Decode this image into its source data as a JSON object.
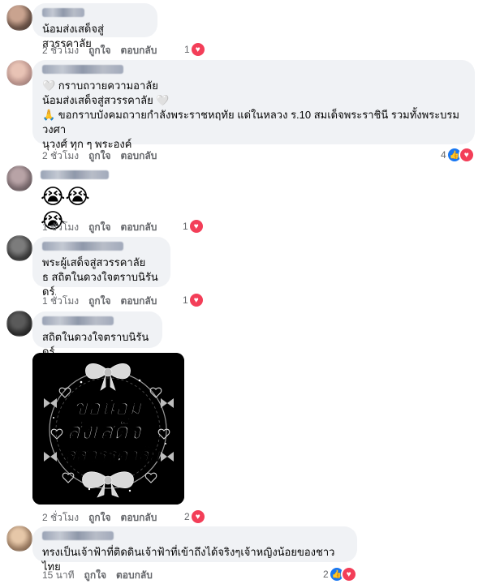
{
  "comments": [
    {
      "text": "น้อมส่งเสด็จสู่สวรรคาลัย",
      "time": "2 ชั่วโมง",
      "like": "ถูกใจ",
      "reply": "ตอบกลับ",
      "count": "1"
    },
    {
      "text": "🤍 กราบถวายความอาลัย\nน้อมส่งเสด็จสู่สวรรคาลัย 🤍\n🙏 ขอกราบบังคมถวายกำลังพระราชหฤทัย แด่ในหลวง ร.10 สมเด็จพระราชินี รวมทั้งพระบรมวงศา\nนุวงศ์ ทุก ๆ พระองค์",
      "time": "2 ชั่วโมง",
      "like": "ถูกใจ",
      "reply": "ตอบกลับ",
      "count": "4"
    },
    {
      "text": "😭😭😭",
      "time": "1 ชั่วโมง",
      "like": "ถูกใจ",
      "reply": "ตอบกลับ",
      "count": "1"
    },
    {
      "text": "พระผู้เสด็จสู่สวรรคาลัย\nธ สถิตในดวงใจตราบนิรันดร์",
      "time": "1 ชั่วโมง",
      "like": "ถูกใจ",
      "reply": "ตอบกลับ",
      "count": "1"
    },
    {
      "text": "สถิตในดวงใจตราบนิรันดร์",
      "time": "2 ชั่วโมง",
      "like": "ถูกใจ",
      "reply": "ตอบกลับ",
      "count": "2"
    },
    {
      "text": "ทรงเป็นเจ้าฟ้าที่ติดดินเจ้าฟ้าที่เข้าถึงได้จริงๆเจ้าหญิงน้อยของชาวไทย",
      "time": "15 นาที",
      "like": "ถูกใจ",
      "reply": "ตอบกลับ",
      "count": "2"
    }
  ],
  "sticker": {
    "line1": "ขอน้อม",
    "line2": "ส่งเสด็จ",
    "line3": "สู่สวรรคาลัย"
  },
  "colors": {
    "heart": "#f33e58",
    "like": "#1877f2",
    "bubble": "#f0f2f5"
  },
  "icons": {
    "heart": "heart-icon",
    "like": "thumbs-up-icon"
  }
}
